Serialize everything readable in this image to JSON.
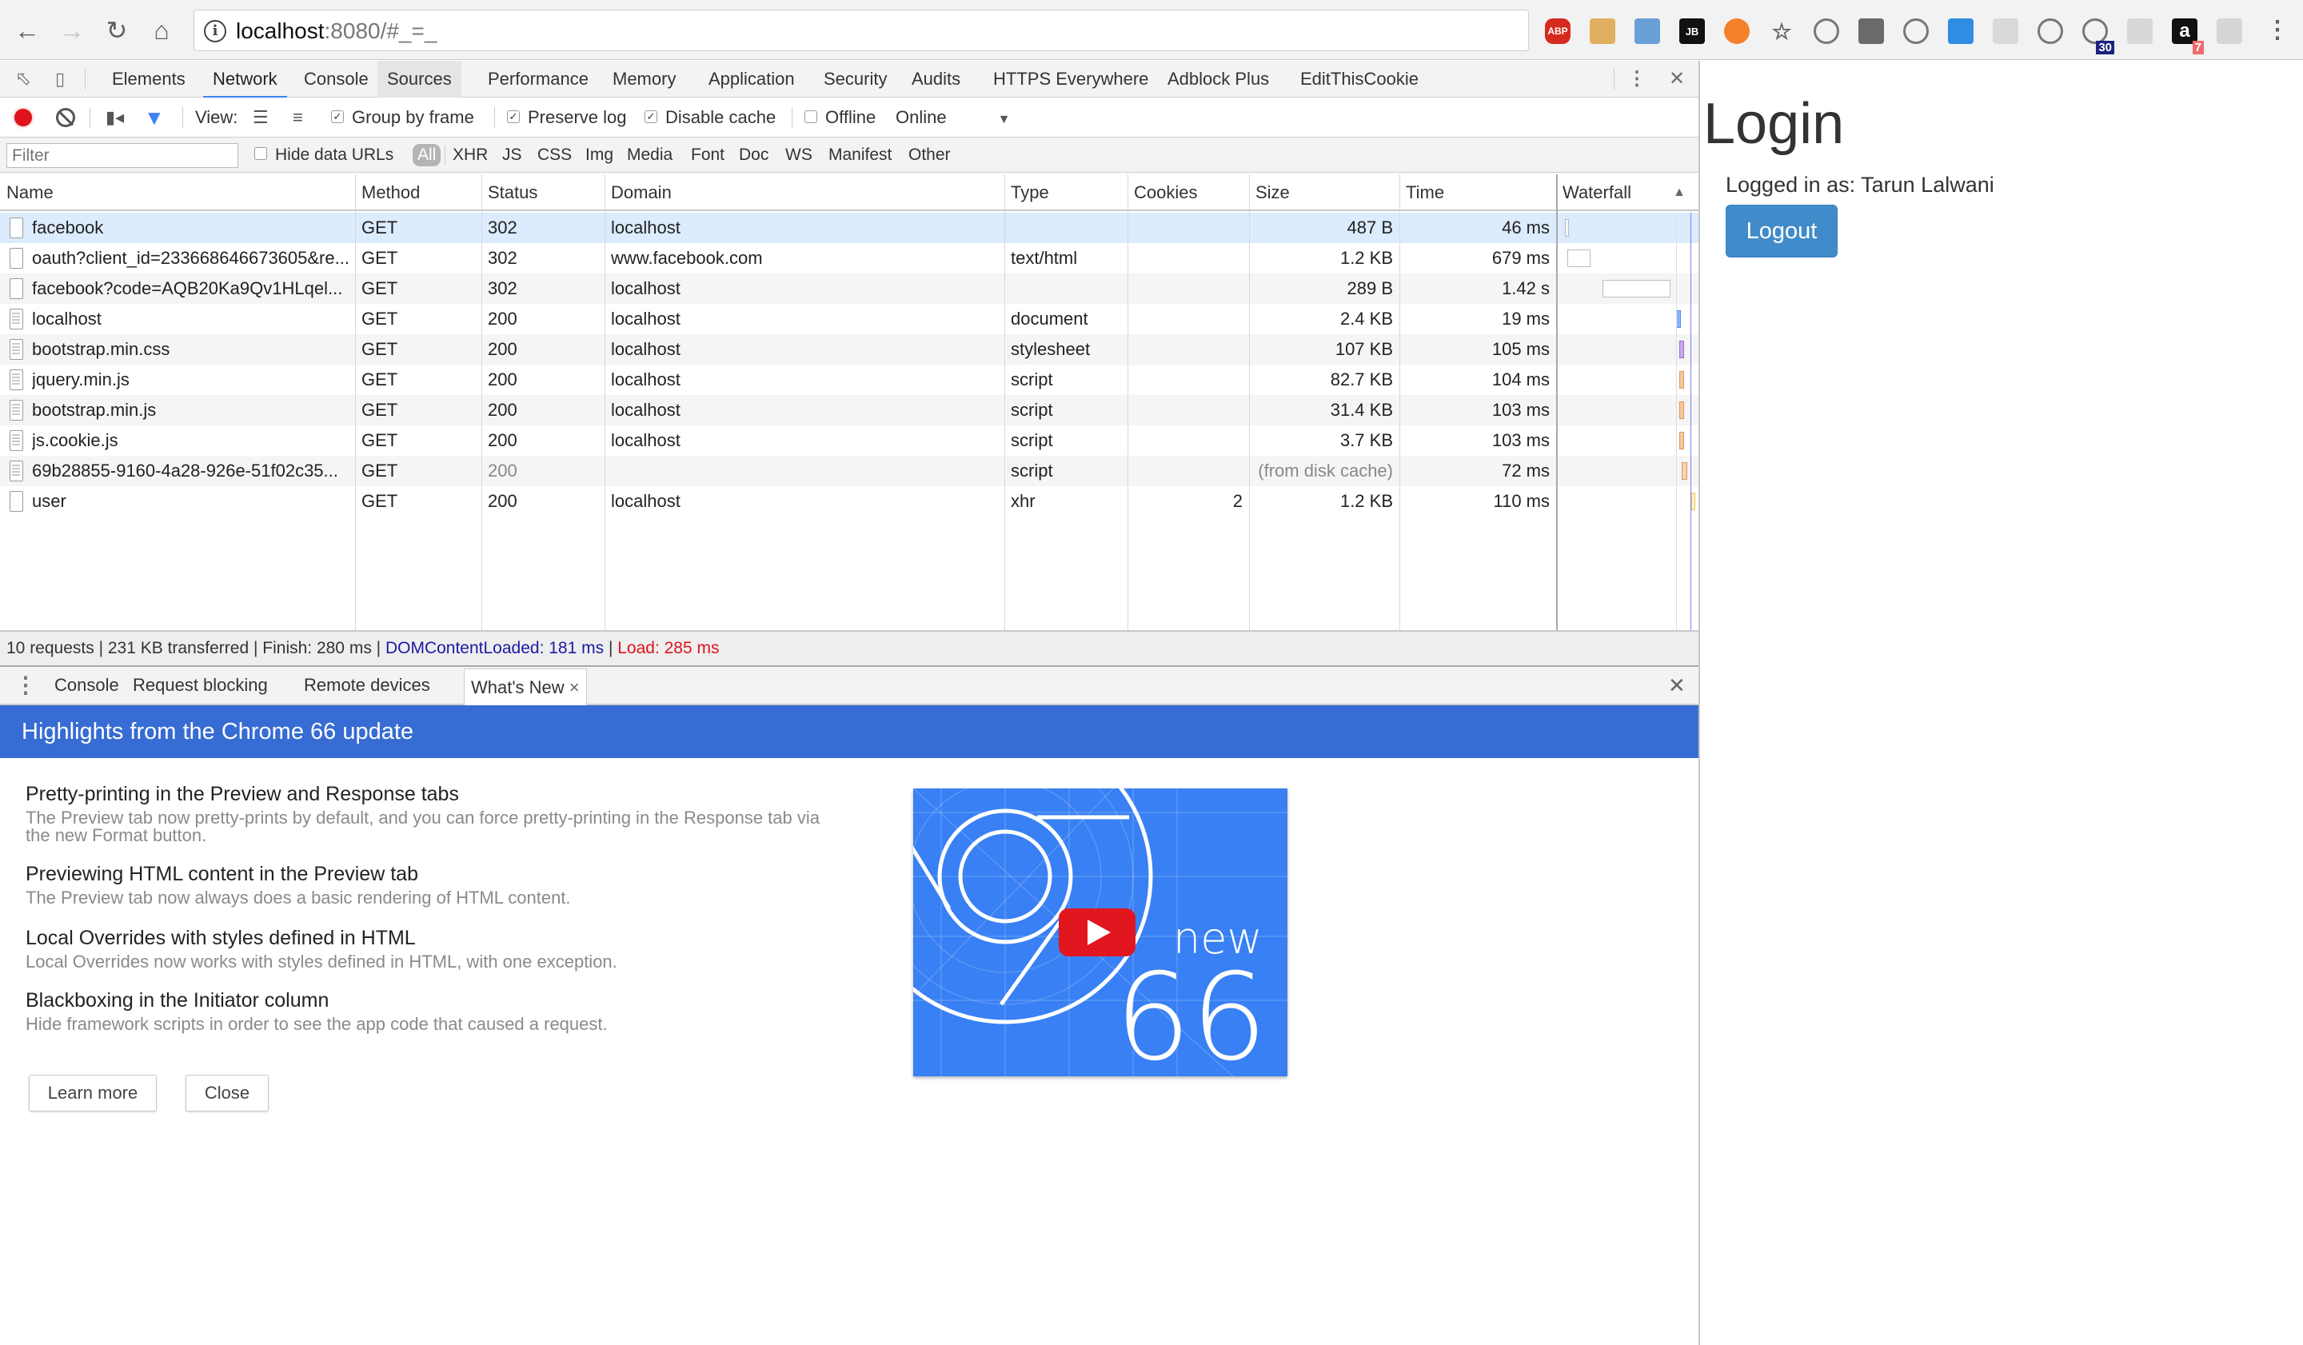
{
  "browser": {
    "url_host": "localhost",
    "url_rest": ":8080/#_=_",
    "nav": {
      "back": "back-icon",
      "forward": "forward-icon",
      "reload": "reload-icon",
      "home": "home-icon"
    },
    "extensions": [
      {
        "name": "adblock-plus-icon",
        "label": "ABP",
        "color": "#d52b1e"
      },
      {
        "name": "cookie-icon",
        "label": "",
        "color": "#e0b060"
      },
      {
        "name": "magnifier-icon",
        "label": "",
        "color": "#6aa0d8"
      },
      {
        "name": "jetbrains-icon",
        "label": "JB",
        "color": "#111111"
      },
      {
        "name": "orange-circle-icon",
        "label": "",
        "color": "#f4802b"
      },
      {
        "name": "star-icon",
        "label": "☆",
        "color": "transparent"
      },
      {
        "name": "1password-icon",
        "label": "",
        "color": "transparent"
      },
      {
        "name": "lightbulb-icon",
        "label": "",
        "color": "#6a6a6a"
      },
      {
        "name": "speaker-icon",
        "label": "",
        "color": "transparent"
      },
      {
        "name": "resize-icon",
        "label": "",
        "color": "#2f8de4"
      },
      {
        "name": "react-icon",
        "label": "",
        "color": "#d9d9d9"
      },
      {
        "name": "film-reel-icon",
        "label": "",
        "color": "transparent"
      },
      {
        "name": "tab-counter-icon",
        "label": "",
        "color": "transparent",
        "badge": "30",
        "badge_color": "#1a237e"
      },
      {
        "name": "share-icon",
        "label": "",
        "color": "#d8d8d8"
      },
      {
        "name": "amazon-icon",
        "label": "a",
        "color": "#111111",
        "badge": "7",
        "badge_color": "#f06b6b"
      },
      {
        "name": "grey-extension-icon",
        "label": "",
        "color": "#d6d6d6"
      }
    ],
    "menu": "kebab-menu-icon"
  },
  "devtools": {
    "tabs": [
      "Elements",
      "Network",
      "Console",
      "Sources",
      "Performance",
      "Memory",
      "Application",
      "Security",
      "Audits",
      "HTTPS Everywhere",
      "Adblock Plus",
      "EditThisCookie"
    ],
    "active_tab": "Network",
    "network_toolbar": {
      "view_label": "View:",
      "group_by_frame": "Group by frame",
      "preserve_log": "Preserve log",
      "disable_cache": "Disable cache",
      "offline": "Offline",
      "throttle": "Online",
      "group_by_frame_checked": true,
      "preserve_log_checked": true,
      "disable_cache_checked": true,
      "offline_checked": false
    },
    "filter": {
      "placeholder": "Filter",
      "hide_data_urls": "Hide data URLs",
      "types": [
        "All",
        "XHR",
        "JS",
        "CSS",
        "Img",
        "Media",
        "Font",
        "Doc",
        "WS",
        "Manifest",
        "Other"
      ],
      "active_type": "All"
    },
    "table": {
      "columns": [
        "Name",
        "Method",
        "Status",
        "Domain",
        "Type",
        "Cookies",
        "Size",
        "Time",
        "Waterfall"
      ],
      "rows": [
        {
          "name": "facebook",
          "method": "GET",
          "status": "302",
          "domain": "localhost",
          "type": "",
          "cookies": "",
          "size": "487 B",
          "time": "46 ms",
          "icon": "blank"
        },
        {
          "name": "oauth?client_id=233668646673605&re...",
          "method": "GET",
          "status": "302",
          "domain": "www.facebook.com",
          "type": "text/html",
          "cookies": "",
          "size": "1.2 KB",
          "time": "679 ms",
          "icon": "blank"
        },
        {
          "name": "facebook?code=AQB20Ka9Qv1HLqel...",
          "method": "GET",
          "status": "302",
          "domain": "localhost",
          "type": "",
          "cookies": "",
          "size": "289 B",
          "time": "1.42 s",
          "icon": "blank"
        },
        {
          "name": "localhost",
          "method": "GET",
          "status": "200",
          "domain": "localhost",
          "type": "document",
          "cookies": "",
          "size": "2.4 KB",
          "time": "19 ms",
          "icon": "doc"
        },
        {
          "name": "bootstrap.min.css",
          "method": "GET",
          "status": "200",
          "domain": "localhost",
          "type": "stylesheet",
          "cookies": "",
          "size": "107 KB",
          "time": "105 ms",
          "icon": "doc"
        },
        {
          "name": "jquery.min.js",
          "method": "GET",
          "status": "200",
          "domain": "localhost",
          "type": "script",
          "cookies": "",
          "size": "82.7 KB",
          "time": "104 ms",
          "icon": "doc"
        },
        {
          "name": "bootstrap.min.js",
          "method": "GET",
          "status": "200",
          "domain": "localhost",
          "type": "script",
          "cookies": "",
          "size": "31.4 KB",
          "time": "103 ms",
          "icon": "doc"
        },
        {
          "name": "js.cookie.js",
          "method": "GET",
          "status": "200",
          "domain": "localhost",
          "type": "script",
          "cookies": "",
          "size": "3.7 KB",
          "time": "103 ms",
          "icon": "doc"
        },
        {
          "name": "69b28855-9160-4a28-926e-51f02c35...",
          "method": "GET",
          "status": "200",
          "domain": "",
          "type": "script",
          "cookies": "",
          "size": "(from disk cache)",
          "time": "72 ms",
          "icon": "doc",
          "muted": true
        },
        {
          "name": "user",
          "method": "GET",
          "status": "200",
          "domain": "localhost",
          "type": "xhr",
          "cookies": "2",
          "size": "1.2 KB",
          "time": "110 ms",
          "icon": "blank"
        }
      ],
      "selected_row": 0
    },
    "status_bar": {
      "requests": "10 requests",
      "transferred": "231 KB transferred",
      "finish": "Finish: 280 ms",
      "dom_content_loaded": "DOMContentLoaded: 181 ms",
      "load": "Load: 285 ms"
    },
    "drawer": {
      "tabs": [
        "Console",
        "Request blocking",
        "Remote devices",
        "What's New"
      ],
      "active_tab": "What's New",
      "banner": "Highlights from the Chrome 66 update",
      "items": [
        {
          "title": "Pretty-printing in the Preview and Response tabs",
          "desc": "The Preview tab now pretty-prints by default, and you can force pretty-printing in the Response tab via the new Format button."
        },
        {
          "title": "Previewing HTML content in the Preview tab",
          "desc": "The Preview tab now always does a basic rendering of HTML content."
        },
        {
          "title": "Local Overrides with styles defined in HTML",
          "desc": "Local Overrides now works with styles defined in HTML, with one exception."
        },
        {
          "title": "Blackboxing in the Initiator column",
          "desc": "Hide framework scripts in order to see the app code that caused a request."
        }
      ],
      "learn_more": "Learn more",
      "close": "Close",
      "video": {
        "word": "new",
        "number": "66"
      }
    }
  },
  "page": {
    "title": "Login",
    "logged_in": "Logged in as: Tarun Lalwani",
    "logout": "Logout"
  },
  "colors": {
    "banner": "#366cd3",
    "selected_row": "#dcebfd",
    "dcl": "#1a1aa6",
    "load": "#e0131c",
    "logout_button": "#428bca"
  }
}
